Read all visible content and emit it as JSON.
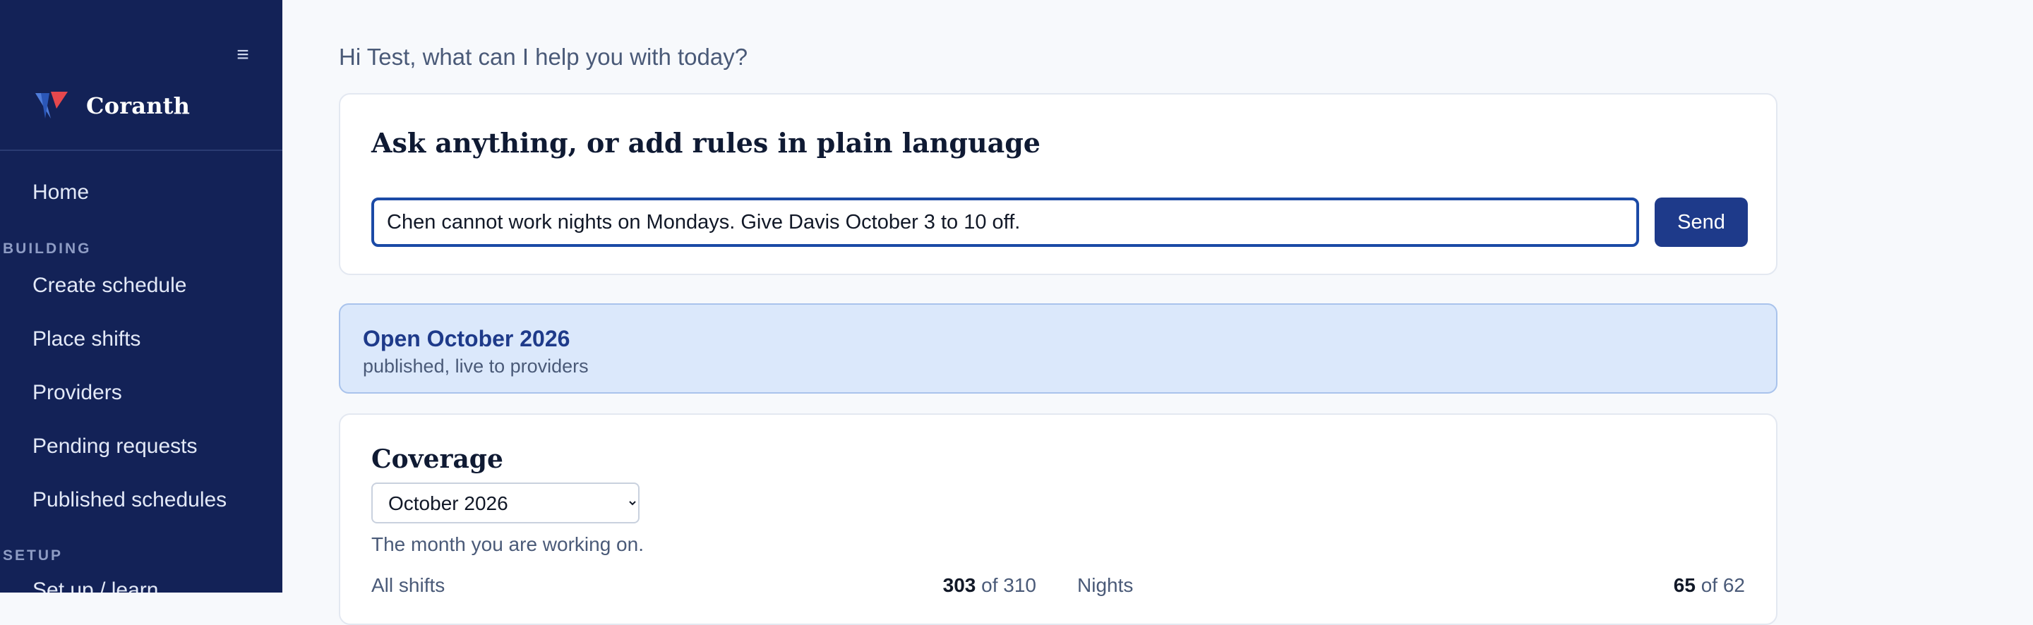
{
  "app": {
    "name": "Coranth"
  },
  "sidebar": {
    "menu_icon": "hamburger-menu-icon",
    "logo_icon": "coranth-logo-icon",
    "home": "Home",
    "sections": [
      {
        "title": "BUILDING",
        "items": [
          "Create schedule",
          "Place shifts",
          "Providers",
          "Pending requests",
          "Published schedules"
        ]
      },
      {
        "title": "SETUP",
        "items": [
          "Set up / learn"
        ]
      }
    ]
  },
  "colors": {
    "sidebar_bg": "#132257",
    "accent": "#1e3a8a",
    "brand_red": "#e5484d",
    "brand_blue": "#4f7ddb",
    "banner_bg": "#dbe8fb"
  },
  "main": {
    "greeting": "Hi Test, what can I help you with today?",
    "ask_card": {
      "title": "Ask anything, or add rules in plain language",
      "input_value": "Chen cannot work nights on Mondays. Give Davis October 3 to 10 off.",
      "send_label": "Send"
    },
    "status": {
      "title": "Open October 2026",
      "subtitle": "published, live to providers"
    },
    "coverage": {
      "title": "Coverage",
      "selected_month": "October 2026",
      "help": "The month you are working on.",
      "stats": [
        {
          "label": "All shifts",
          "value": "303",
          "of_text": "of 310"
        },
        {
          "label": "Nights",
          "value": "65",
          "of_text": "of 62"
        }
      ]
    }
  }
}
